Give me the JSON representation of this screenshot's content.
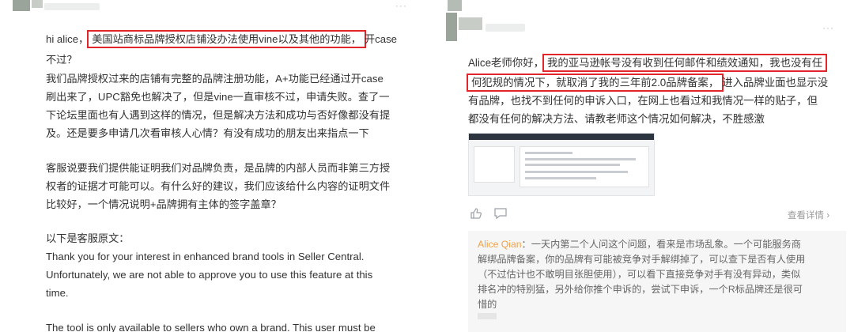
{
  "left_post": {
    "lines": [
      {
        "pre": "hi alice，",
        "highlight": "美国站商标品牌授权店铺没办法使用vine以及其他的功能，",
        "post": "开case"
      },
      {
        "text": "不过？"
      },
      {
        "text": "我们品牌授权过来的店铺有完整的品牌注册功能，A+功能已经通过开case"
      },
      {
        "text": "刷出来了，UPC豁免也解决了，但是vine一直审核不过，申请失败。查了一"
      },
      {
        "text": "下论坛里面也有人遇到这样的情况，但是解决方法和成功与否好像都没有提"
      },
      {
        "text": "及。还是要多申请几次看审核人心情？有没有成功的朋友出来指点一下"
      },
      {
        "text": ""
      },
      {
        "text": "客服说要我们提供能证明我们对品牌负责，是品牌的内部人员而非第三方授"
      },
      {
        "text": "权者的证据才可能可以。有什么好的建议，我们应该给什么内容的证明文件"
      },
      {
        "text": "比较好，一个情况说明+品牌拥有主体的签字盖章？"
      },
      {
        "text": ""
      },
      {
        "text": "以下是客服原文："
      },
      {
        "text": "Thank you for your interest in enhanced brand tools in Seller Central."
      },
      {
        "text": "Unfortunately, we are not able to approve you to use this feature at this"
      },
      {
        "text": "time."
      },
      {
        "text": ""
      },
      {
        "text": "The tool is only available to sellers who own a brand. This user must be"
      }
    ],
    "more_label": "···"
  },
  "right_post": {
    "more_label": "···",
    "lines": [
      {
        "pre": "Alice老师你好，",
        "highlight": "我的亚马逊帐号没有收到任何邮件和绩效通知，我也没有任",
        "post": ""
      },
      {
        "pre": "",
        "highlight": "何犯规的情况下，就取消了我的三年前2.0品牌备案，",
        "post": "进入品牌业面也显示没"
      },
      {
        "text": "有品牌，也找不到任何的申诉入口，在网上也看过和我情况一样的贴子，但"
      },
      {
        "text": "都没有任何的解决方法、请教老师这个情况如何解决，不胜感激"
      }
    ],
    "details_label": "查看详情 ›",
    "reply": {
      "author": "Alice Qian",
      "first_line_rest": "：一天内第二个人问这个问题，看来是市场乱象。一个可能服务商",
      "lines": [
        "解绑品牌备案，你的品牌有可能被竞争对手解绑掉了，可以查下是否有人使用",
        "（不过估计也不敢明目张胆使用），可以看下直接竞争对手有没有异动，类似",
        "排名冲的特别猛，另外给你推个申诉的，尝试下申诉，一个R标品牌还是很可",
        "惜的"
      ]
    }
  }
}
